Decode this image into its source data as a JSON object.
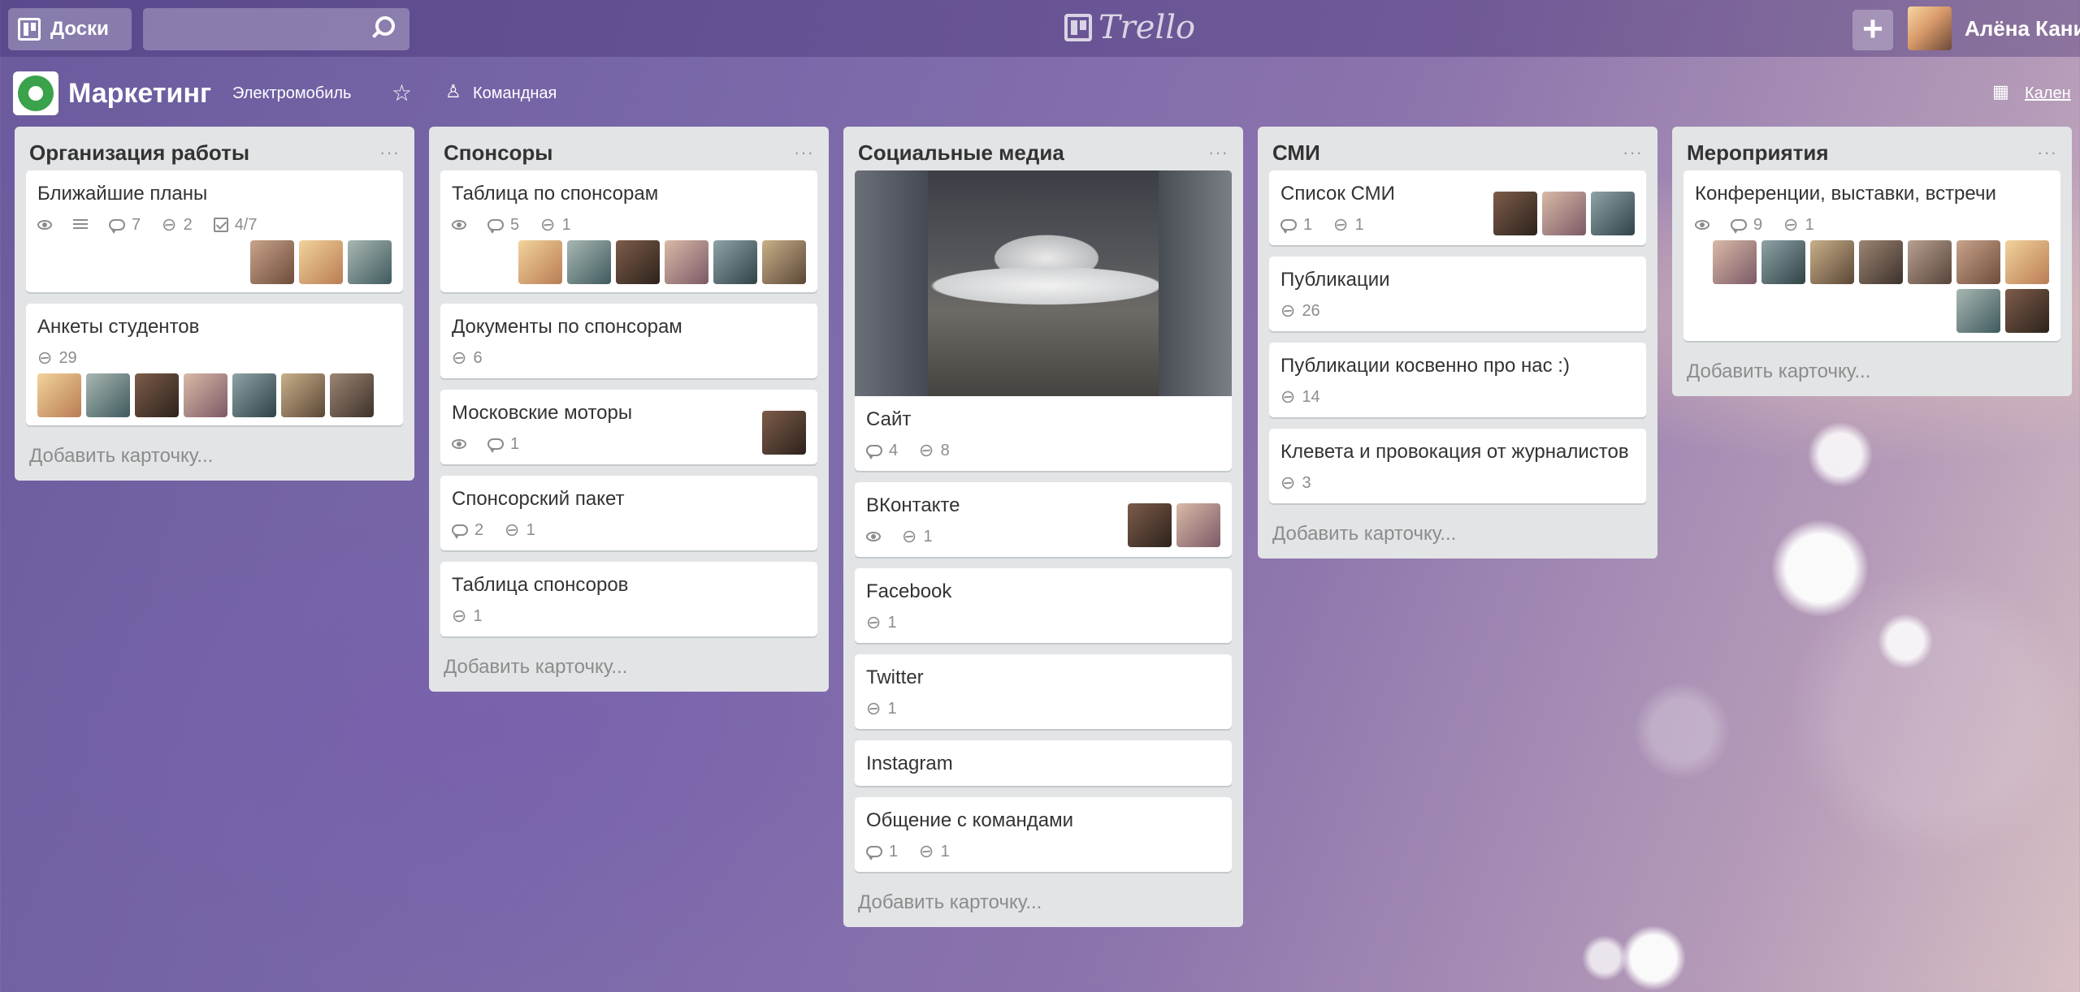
{
  "topbar": {
    "boards_label": "Доски",
    "search_value": "",
    "logo_text": "Trello",
    "plus_label": "+",
    "user_name": "Алёна Кани"
  },
  "board": {
    "title": "Маркетинг",
    "org": "Электромобиль",
    "visibility": "Командная",
    "calendar_label": "Кален"
  },
  "add_card_label": "Добавить карточку...",
  "menu_label": "···",
  "lists": [
    {
      "title": "Организация работы",
      "cards": [
        {
          "title": "Ближайшие планы",
          "badges": {
            "watch": true,
            "desc": true,
            "comments": "7",
            "attachments": "2",
            "checklist": "4/7"
          },
          "members": 3
        },
        {
          "title": "Анкеты студентов",
          "badges": {
            "attachments": "29"
          },
          "members": 7
        }
      ]
    },
    {
      "title": "Спонсоры",
      "cards": [
        {
          "title": "Таблица по спонсорам",
          "badges": {
            "watch": true,
            "comments": "5",
            "attachments": "1"
          },
          "members": 6
        },
        {
          "title": "Документы по спонсорам",
          "badges": {
            "attachments": "6"
          },
          "members": 0
        },
        {
          "title": "Московские моторы",
          "badges": {
            "watch": true,
            "comments": "1"
          },
          "members": 1
        },
        {
          "title": "Спонсорский пакет",
          "badges": {
            "comments": "2",
            "attachments": "1"
          },
          "members": 0
        },
        {
          "title": "Таблица спонсоров",
          "badges": {
            "attachments": "1"
          },
          "members": 0
        }
      ]
    },
    {
      "title": "Социальные медиа",
      "cards": [
        {
          "title": "Сайт",
          "cover": true,
          "badges": {
            "comments": "4",
            "attachments": "8"
          },
          "members": 0
        },
        {
          "title": "ВКонтакте",
          "badges": {
            "watch": true,
            "attachments": "1"
          },
          "members": 2
        },
        {
          "title": "Facebook",
          "badges": {
            "attachments": "1"
          },
          "members": 0
        },
        {
          "title": "Twitter",
          "badges": {
            "attachments": "1"
          },
          "members": 0
        },
        {
          "title": "Instagram",
          "badges": {},
          "members": 0
        },
        {
          "title": "Общение с командами",
          "badges": {
            "comments": "1",
            "attachments": "1"
          },
          "members": 0
        }
      ]
    },
    {
      "title": "СМИ",
      "cards": [
        {
          "title": "Список СМИ",
          "badges": {
            "comments": "1",
            "attachments": "1"
          },
          "members": 3
        },
        {
          "title": "Публикации",
          "badges": {
            "attachments": "26"
          },
          "members": 0
        },
        {
          "title": "Публикации косвенно про нас :)",
          "badges": {
            "attachments": "14"
          },
          "members": 0
        },
        {
          "title": "Клевета и провокация от журналистов",
          "badges": {
            "attachments": "3"
          },
          "members": 0
        }
      ]
    },
    {
      "title": "Мероприятия",
      "cards": [
        {
          "title": "Конференции, выставки, встречи",
          "badges": {
            "watch": true,
            "comments": "9",
            "attachments": "1"
          },
          "members": 9
        }
      ]
    }
  ]
}
